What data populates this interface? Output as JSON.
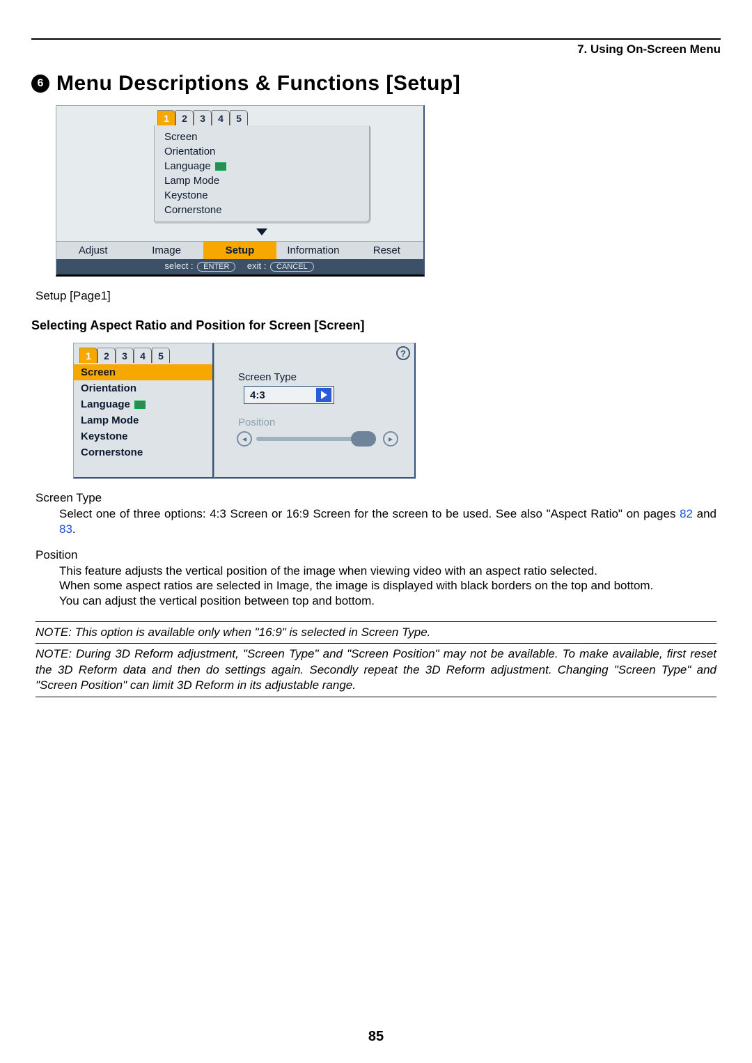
{
  "header": {
    "chapter": "7. Using On-Screen Menu"
  },
  "title": {
    "num": "6",
    "text": "Menu Descriptions & Functions [Setup]"
  },
  "menu1": {
    "tabs": [
      "1",
      "2",
      "3",
      "4",
      "5"
    ],
    "items": [
      "Screen",
      "Orientation",
      "Language",
      "Lamp Mode",
      "Keystone",
      "Cornerstone"
    ],
    "nav": {
      "adjust": "Adjust",
      "image": "Image",
      "setup": "Setup",
      "info": "Information",
      "reset": "Reset"
    },
    "hint_select": "select :",
    "hint_enter": "ENTER",
    "hint_exit": "exit :",
    "hint_cancel": "CANCEL"
  },
  "caption1": "Setup [Page1]",
  "subhead": "Selecting Aspect Ratio and Position for Screen [Screen]",
  "panelA": {
    "tabs": [
      "1",
      "2",
      "3",
      "4",
      "5"
    ],
    "items": [
      "Screen",
      "Orientation",
      "Language",
      "Lamp Mode",
      "Keystone",
      "Cornerstone"
    ],
    "selected": "Screen"
  },
  "panelB": {
    "screen_type_label": "Screen Type",
    "screen_type_value": "4:3",
    "position_label": "Position",
    "help": "?"
  },
  "body": {
    "st_title": "Screen Type",
    "st_text_a": "Select one of three options: 4:3 Screen or 16:9 Screen for the screen to be used. See also \"Aspect Ratio\" on pages ",
    "st_link1": "82",
    "st_mid": " and ",
    "st_link2": "83",
    "st_end": ".",
    "pos_title": "Position",
    "pos_p1": "This feature adjusts the vertical position of the image when viewing video with an aspect ratio selected.",
    "pos_p2": "When some aspect ratios are selected in Image, the image is displayed with black borders on the top and bottom.",
    "pos_p3": "You can adjust the vertical position between top and bottom.",
    "note1": "NOTE: This option is available only when \"16:9\" is selected in Screen Type.",
    "note2": "NOTE: During 3D Reform adjustment, \"Screen Type\" and \"Screen Position\" may not be available. To make available, first reset the 3D Reform data and then do settings again. Secondly repeat the 3D Reform adjustment. Changing \"Screen Type\" and \"Screen Position\" can limit 3D Reform in its adjustable range."
  },
  "page_number": "85"
}
